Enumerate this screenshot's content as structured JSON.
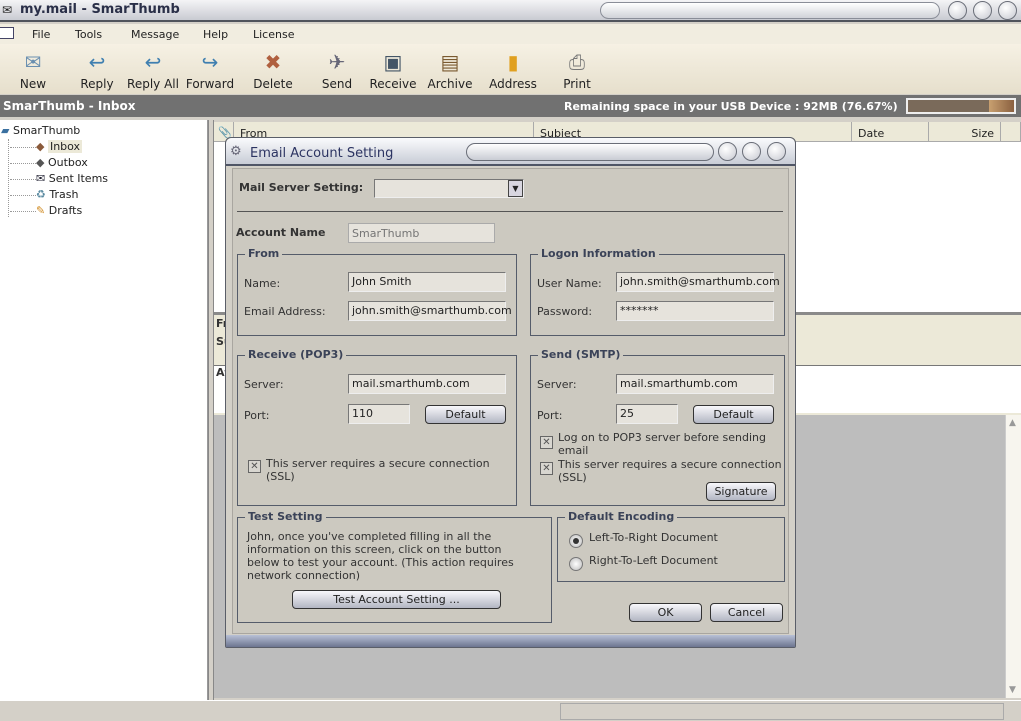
{
  "window": {
    "title": "my.mail - SmarThumb"
  },
  "menu": [
    "File",
    "Tools",
    "Message",
    "Help",
    "License"
  ],
  "toolbar": [
    {
      "label": "New",
      "icon": "envelope-icon"
    },
    {
      "label": "Reply",
      "icon": "reply-icon"
    },
    {
      "label": "Reply All",
      "icon": "reply-all-icon"
    },
    {
      "label": "Forward",
      "icon": "forward-icon"
    },
    {
      "label": "Delete",
      "icon": "delete-icon"
    },
    {
      "label": "Send",
      "icon": "send-icon"
    },
    {
      "label": "Receive",
      "icon": "receive-icon"
    },
    {
      "label": "Archive",
      "icon": "archive-icon"
    },
    {
      "label": "Address",
      "icon": "address-book-icon"
    },
    {
      "label": "Print",
      "icon": "printer-icon"
    }
  ],
  "inbox_bar": {
    "title": "SmarThumb - Inbox",
    "space_text": "Remaining space in your USB Device :  92MB (76.67%)",
    "space_percent": 76.67
  },
  "tree": {
    "root": "SmarThumb",
    "folders": [
      "Inbox",
      "Outbox",
      "Sent Items",
      "Trash",
      "Drafts"
    ],
    "selected": "Inbox"
  },
  "list": {
    "columns": [
      "From",
      "Subject",
      "Date",
      "Size"
    ]
  },
  "preview": {
    "labels": [
      "Fr",
      "Su",
      "At"
    ]
  },
  "dialog": {
    "title": "Email Account Setting",
    "mail_server_label": "Mail Server Setting:",
    "mail_server_value": "",
    "account_name_label": "Account Name",
    "account_name_placeholder": "SmarThumb",
    "from": {
      "legend": "From",
      "name_label": "Name:",
      "name": "John Smith",
      "email_label": "Email Address:",
      "email": "john.smith@smarthumb.com"
    },
    "logon": {
      "legend": "Logon Information",
      "user_label": "User Name:",
      "user": "john.smith@smarthumb.com",
      "password_label": "Password:",
      "password": "*******"
    },
    "receive": {
      "legend": "Receive (POP3)",
      "server_label": "Server:",
      "server": "mail.smarthumb.com",
      "port_label": "Port:",
      "port": "110",
      "default_label": "Default",
      "ssl_label": "This server requires a secure connection (SSL)",
      "ssl_checked": true
    },
    "send": {
      "legend": "Send (SMTP)",
      "server_label": "Server:",
      "server": "mail.smarthumb.com",
      "port_label": "Port:",
      "port": "25",
      "default_label": "Default",
      "pop_label": "Log on to POP3 server before sending email",
      "pop_checked": true,
      "ssl_label": "This server requires a secure connection (SSL)",
      "ssl_checked": true,
      "signature_label": "Signature"
    },
    "test": {
      "legend": "Test Setting",
      "text": "John, once you've completed filling in all the information on this screen, click on the button below to test your account. (This action requires network connection)",
      "button": "Test Account Setting ..."
    },
    "encoding": {
      "legend": "Default Encoding",
      "options": [
        "Left-To-Right Document",
        "Right-To-Left Document"
      ],
      "selected": "Left-To-Right Document"
    },
    "ok_label": "OK",
    "cancel_label": "Cancel"
  }
}
